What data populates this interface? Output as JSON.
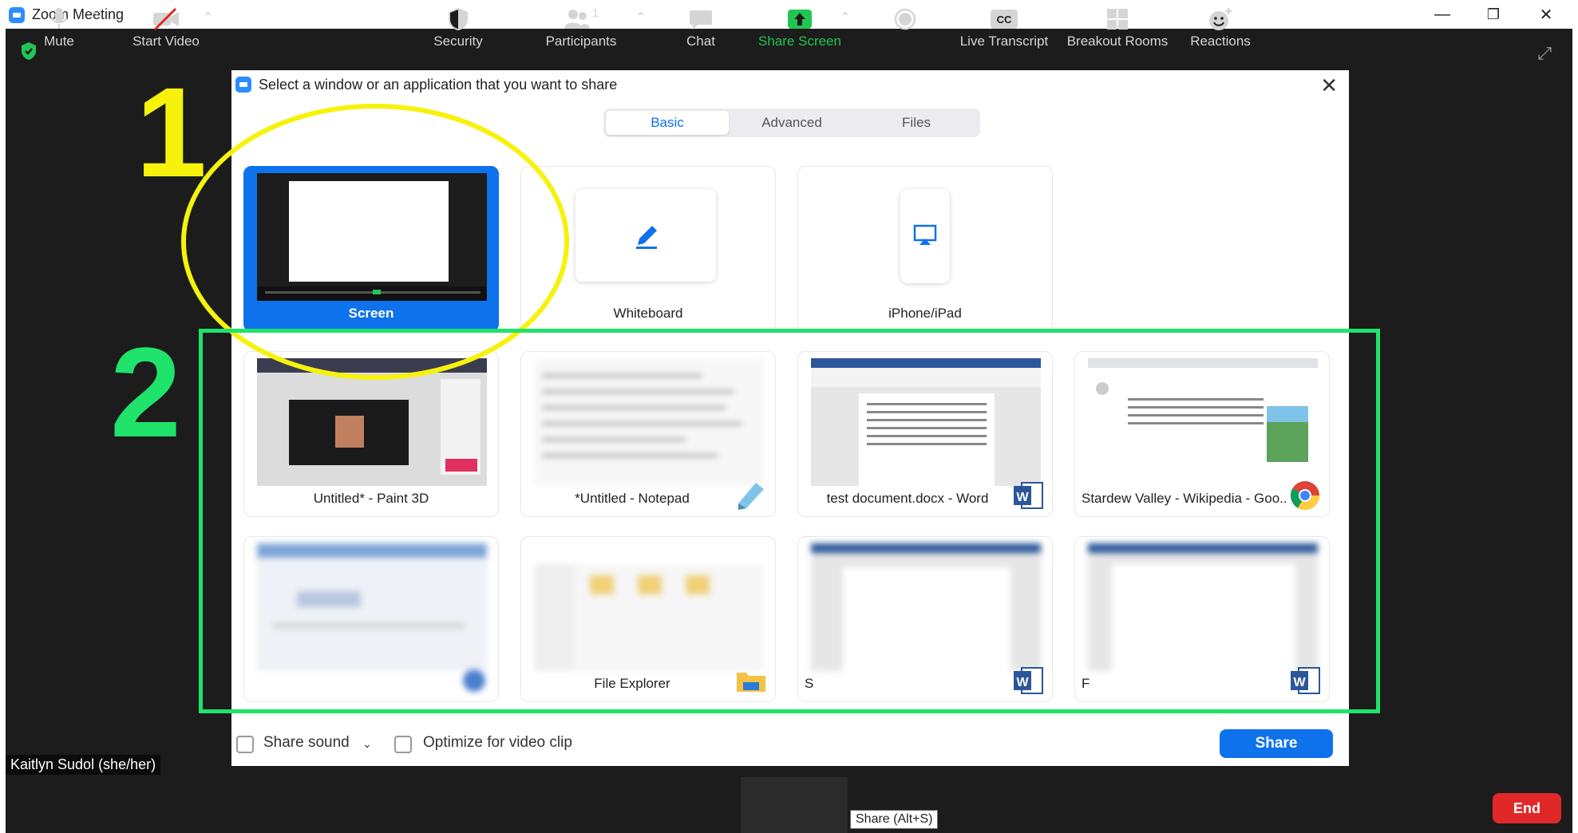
{
  "window": {
    "title": "Zoom Meeting",
    "minimize": "—",
    "restore": "❐",
    "close": "✕"
  },
  "annotations": {
    "one": "1",
    "two": "2"
  },
  "dialog": {
    "title": "Select a window or an application that you want to share",
    "close": "✕",
    "tabs": [
      {
        "label": "Basic",
        "active": true
      },
      {
        "label": "Advanced",
        "active": false
      },
      {
        "label": "Files",
        "active": false
      }
    ],
    "tiles_basic": [
      {
        "label": "Screen",
        "selected": true,
        "icon": "screen-preview"
      },
      {
        "label": "Whiteboard",
        "selected": false,
        "icon": "pencil-icon"
      },
      {
        "label": "iPhone/iPad",
        "selected": false,
        "icon": "airplay-icon"
      }
    ],
    "windows_row1": [
      {
        "label": "Untitled* - Paint 3D",
        "app_icon": ""
      },
      {
        "label": "*Untitled - Notepad",
        "app_icon": "notepad-icon"
      },
      {
        "label": "test document.docx - Word",
        "app_icon": "word-icon"
      },
      {
        "label": "Stardew Valley - Wikipedia - Goo...",
        "app_icon": "chrome-icon"
      }
    ],
    "windows_row2": [
      {
        "label": "",
        "app_icon": "blurred-app-icon"
      },
      {
        "label": "File Explorer",
        "app_icon": "folder-icon"
      },
      {
        "label": "S",
        "app_icon": "word-icon"
      },
      {
        "label": "F",
        "app_icon": "word-icon"
      }
    ],
    "share_sound": "Share sound",
    "optimize_video": "Optimize for video clip",
    "share_button": "Share"
  },
  "participant_name": "Kaitlyn Sudol (she/her)",
  "toolbar": {
    "mute": "Mute",
    "start_video": "Start Video",
    "security": "Security",
    "participants": "Participants",
    "participants_count": "1",
    "chat": "Chat",
    "share_screen": "Share Screen",
    "tooltip": "Share (Alt+S)",
    "live_transcript": "Live Transcript",
    "breakout_rooms": "Breakout Rooms",
    "reactions": "Reactions",
    "end": "End",
    "cc": "CC"
  },
  "colors": {
    "accent": "#0e72ed",
    "annotation_yellow": "#f6f20b",
    "annotation_green": "#1fe36a",
    "end_red": "#e02828",
    "share_green": "#23c552"
  }
}
